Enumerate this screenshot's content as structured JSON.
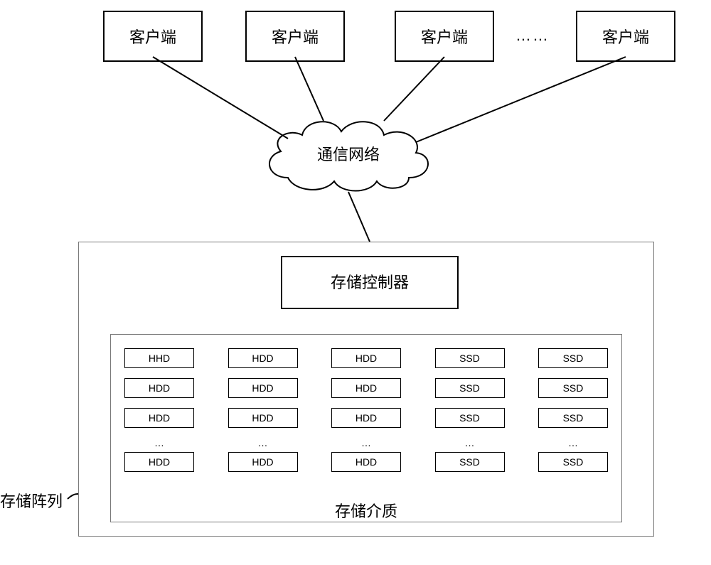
{
  "clients": [
    {
      "label": "客户端"
    },
    {
      "label": "客户端"
    },
    {
      "label": "客户端"
    },
    {
      "label": "客户端"
    }
  ],
  "client_ellipsis": "……",
  "network": {
    "label": "通信网络"
  },
  "storage": {
    "controller_label": "存储控制器",
    "media_label": "存储介质",
    "array_label": "存储阵列"
  },
  "drives": {
    "rows": [
      [
        "HHD",
        "HDD",
        "HDD",
        "SSD",
        "SSD"
      ],
      [
        "HDD",
        "HDD",
        "HDD",
        "SSD",
        "SSD"
      ],
      [
        "HDD",
        "HDD",
        "HDD",
        "SSD",
        "SSD"
      ],
      [
        "HDD",
        "HDD",
        "HDD",
        "SSD",
        "SSD"
      ]
    ],
    "dots": "…"
  }
}
